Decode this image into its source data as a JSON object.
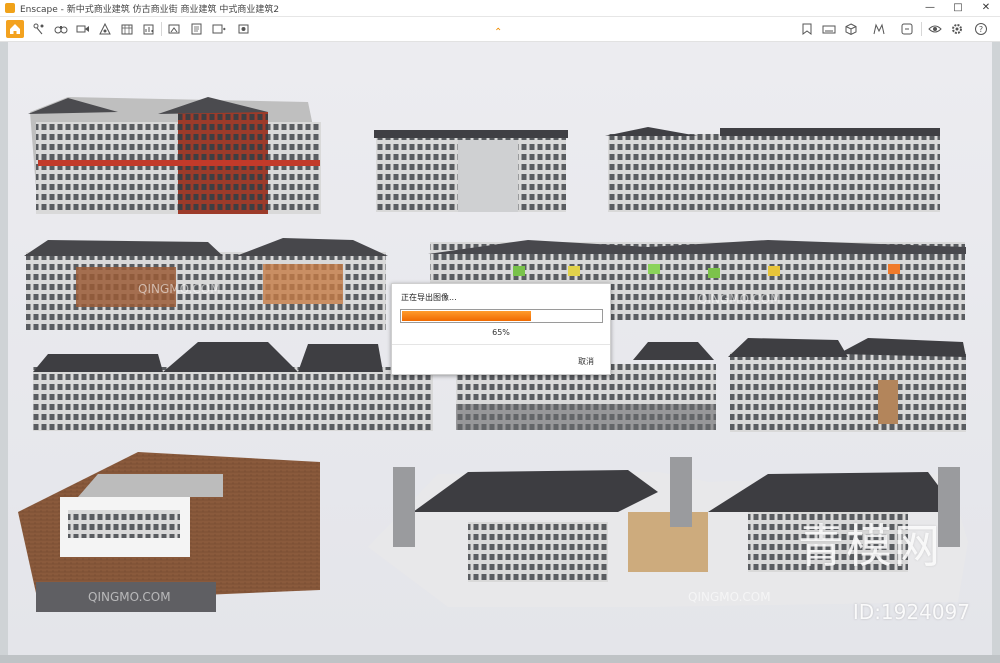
{
  "window": {
    "title": "Enscape - 新中式商业建筑 仿古商业街 商业建筑 中式商业建筑2",
    "controls": {
      "minimize": "—",
      "maximize": "□",
      "close": "✕"
    }
  },
  "toolbar": {
    "left_icons": [
      "home-icon",
      "walk-icon",
      "binoculars-icon",
      "video-icon",
      "hand-icon",
      "map-icon",
      "chart-icon",
      "image-icon",
      "document-icon",
      "export-icon",
      "render-icon"
    ],
    "right_icons": [
      "asset-library-icon",
      "panorama-icon",
      "cube-icon",
      "batch-icon",
      "tag-icon",
      "settings-icon",
      "eye-icon",
      "gear-icon",
      "help-icon"
    ]
  },
  "export_dialog": {
    "message": "正在导出图像...",
    "progress_percent_label": "65%",
    "progress": 0.65,
    "cancel_label": "取消"
  },
  "watermarks": {
    "brand": "青模网",
    "id": "ID:1924097",
    "small": "QINGMO.COM"
  },
  "colors": {
    "accent": "#f3a21f",
    "progress_fill": "#f06a00"
  }
}
